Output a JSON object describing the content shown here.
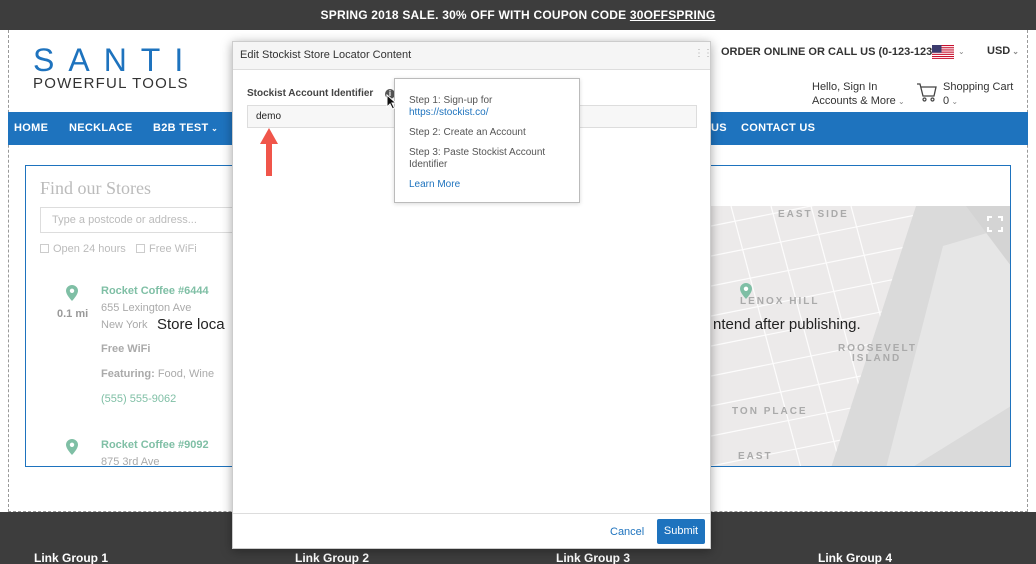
{
  "promo": {
    "text": "SPRING 2018 SALE. 30% OFF WITH COUPON CODE ",
    "code": "30OFFSPRING"
  },
  "header": {
    "logo_top": "SANTI",
    "logo_bottom": "POWERFUL TOOLS",
    "order_text": "ORDER ONLINE OR CALL US (0-123-1234)",
    "flag_icon": "us-flag-icon",
    "currency": "USD",
    "account_line1": "Hello, Sign In",
    "account_line2": "Accounts & More",
    "cart_label": "Shopping Cart",
    "cart_count": "0"
  },
  "nav": {
    "items": [
      "HOME",
      "NECKLACE",
      "B2B TEST",
      "US",
      "CONTACT US"
    ]
  },
  "store_locator": {
    "title": "Find our Stores",
    "search_placeholder": "Type a postcode or address...",
    "filter_open": "Open 24 hours",
    "filter_wifi": "Free WiFi",
    "locations": [
      {
        "name": "Rocket Coffee #6444",
        "address1": "655 Lexington Ave",
        "address2": "New York",
        "distance": "0.1 mi",
        "amenity": "Free WiFi",
        "featuring_label": "Featuring:",
        "featuring_value": " Food, Wine",
        "phone": "(555) 555-9062"
      },
      {
        "name": "Rocket Coffee #9092",
        "address1": "875 3rd Ave"
      }
    ],
    "overlay_left": "Store loca",
    "overlay_right": "ntend after publishing.",
    "map_labels": [
      "EAST SIDE",
      "LENOX HILL",
      "ROOSEVELT",
      "ISLAND",
      "TON PLACE",
      "EAST"
    ]
  },
  "modal": {
    "title": "Edit Stockist Store Locator Content",
    "field_label": "Stockist Account Identifier",
    "field_value": "demo",
    "cancel_label": "Cancel",
    "submit_label": "Submit"
  },
  "tooltip": {
    "step1": "Step 1: Sign-up for",
    "step1_link": "https://stockist.co/",
    "step2": "Step 2: Create an Account",
    "step3": "Step 3: Paste Stockist Account Identifier",
    "learn_more": "Learn More"
  },
  "footer": {
    "columns": [
      "Link Group 1",
      "Link Group 2",
      "Link Group 3",
      "Link Group 4"
    ]
  },
  "colors": {
    "brand_blue": "#1e73be",
    "dark_bar": "#3d3d3d",
    "arrow_red": "#f0554a",
    "pin_green": "#7fbfa5"
  }
}
